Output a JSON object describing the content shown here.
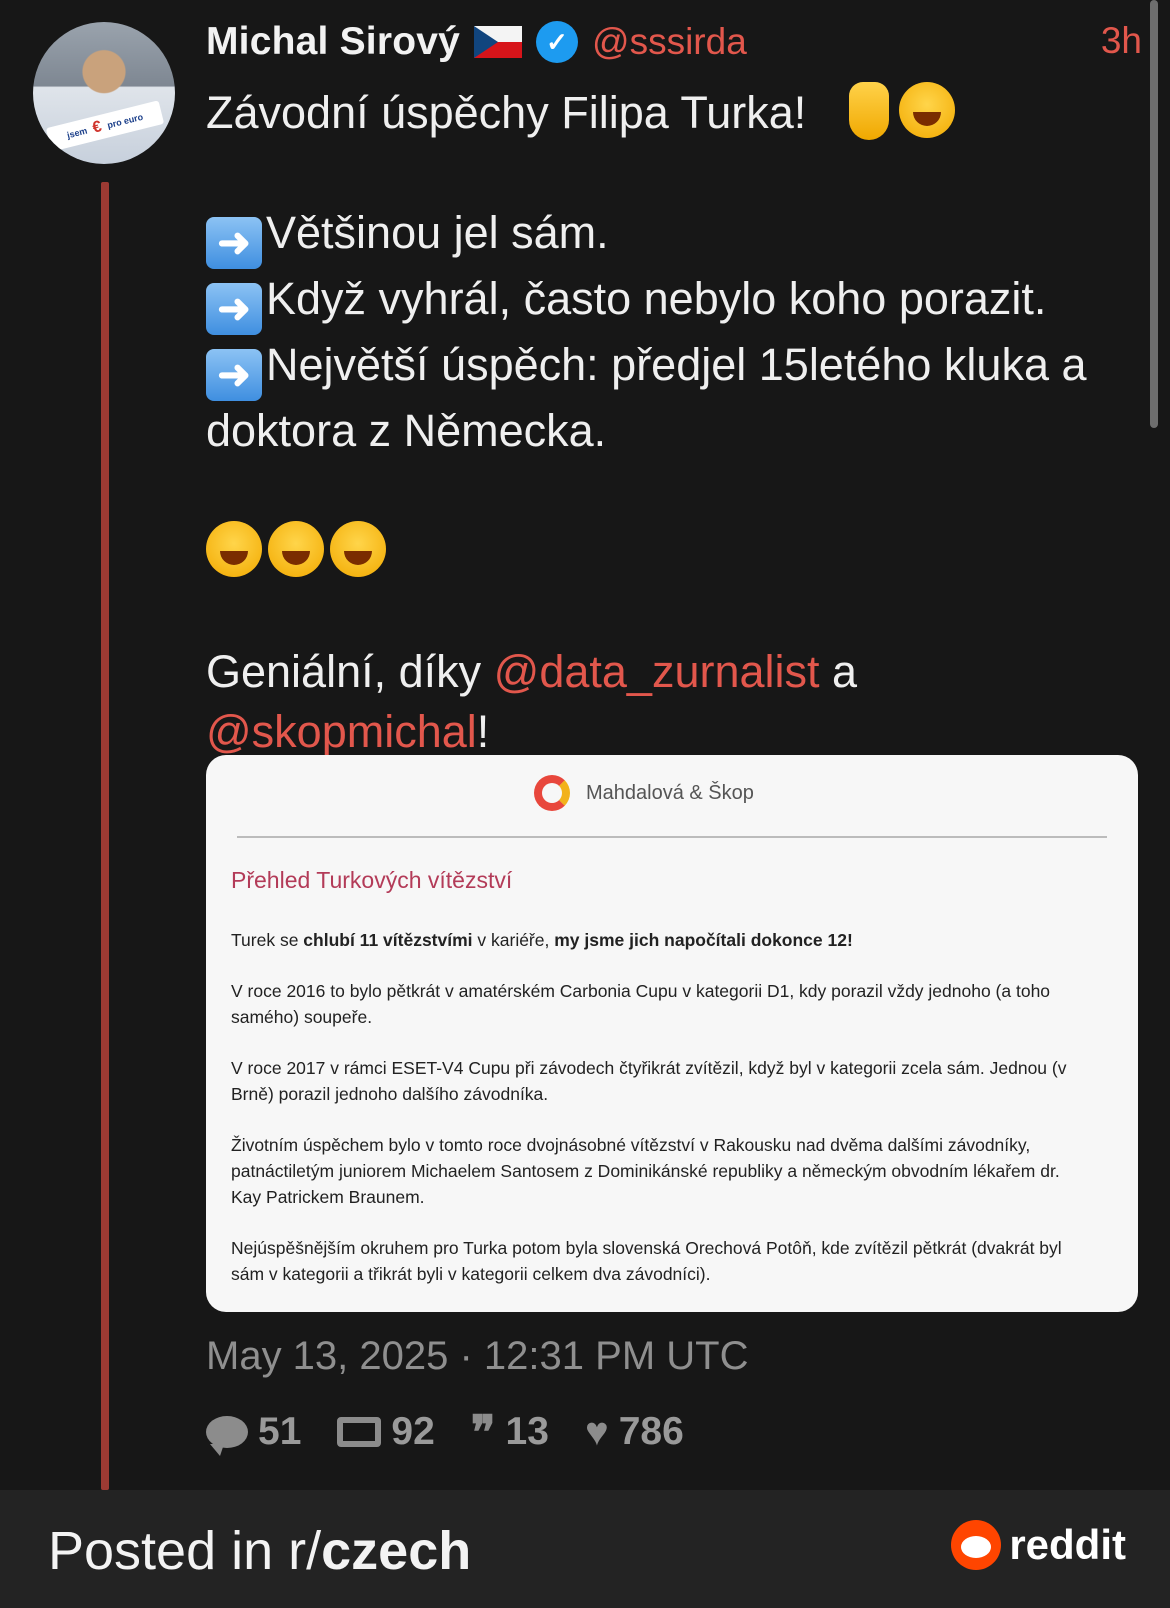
{
  "author": {
    "name": "Michal Sirový",
    "handle": "@sssirda",
    "time": "3h",
    "avatar_banner_left": "jsem",
    "avatar_banner_right": "pro euro"
  },
  "tweet": {
    "line1": "Závodní úspěchy Filipa Turka!",
    "bullet1": "Většinou jel sám.",
    "bullet2": "Když vyhrál, často nebylo koho porazit.",
    "bullet3": "Největší úspěch: předjel 15letého kluka a doktora z Německa.",
    "thanks_prefix": "Geniální, díky ",
    "mention1": "@data_zurnalist",
    "thanks_mid": " a",
    "mention2": "@skopmichal",
    "thanks_suffix": "!"
  },
  "card": {
    "brand": "Mahdalová & Škop",
    "heading": "Přehled Turkových vítězství",
    "p1_a": "Turek se ",
    "p1_b": "chlubí 11 vítězstvími",
    "p1_c": " v kariéře, ",
    "p1_d": "my jsme jich napočítali dokonce 12!",
    "p2": "V roce 2016 to bylo pětkrát v amatérském Carbonia Cupu v kategorii D1, kdy porazil vždy jednoho (a toho samého) soupeře.",
    "p3": "V roce 2017 v rámci ESET-V4 Cupu při závodech čtyřikrát zvítězil, když byl v kategorii zcela sám. Jednou (v Brně) porazil jednoho dalšího závodníka.",
    "p4": "Životním úspěchem bylo v tomto roce dvojnásobné vítězství v Rakousku nad dvěma dalšími závodníky, patnáctiletým juniorem Michaelem Santosem z Dominikánské republiky a německým obvodním lékařem dr. Kay Patrickem Braunem.",
    "p5": "Nejúspěšnějším okruhem pro Turka potom byla slovenská Orechová Potôň, kde zvítězil pětkrát (dvakrát byl sám v kategorii a třikrát byli v kategorii celkem dva závodníci)."
  },
  "meta": {
    "date": "May 13, 2025 · 12:31 PM UTC"
  },
  "stats": {
    "replies": "51",
    "retweets": "92",
    "quotes": "13",
    "likes": "786"
  },
  "footer": {
    "posted_prefix": "Posted in r/",
    "subreddit": "czech",
    "brand": "reddit"
  },
  "colors": {
    "accent": "#e2574c",
    "thread_line": "#9c3a33",
    "verified": "#1d9bf0",
    "card_heading": "#b33b58"
  }
}
